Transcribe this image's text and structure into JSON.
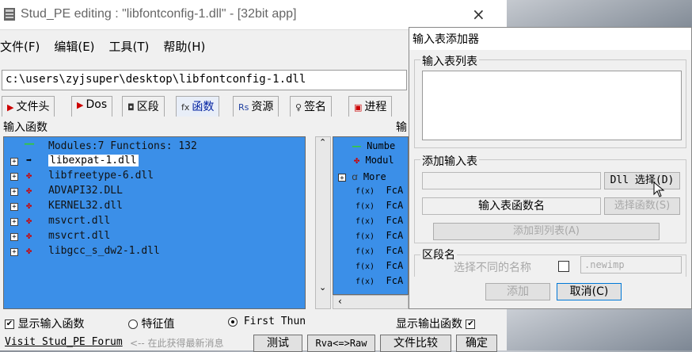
{
  "window": {
    "title": "Stud_PE editing : \"libfontconfig-1.dll\" - [32bit app]",
    "close": "×"
  },
  "menu": [
    "文件(F)",
    "编辑(E)",
    "工具(T)",
    "帮助(H)"
  ],
  "path": "c:\\users\\zyjsuper\\desktop\\libfontconfig-1.dll",
  "tabs": [
    {
      "icon": "arrow-icon",
      "label": "文件头"
    },
    {
      "icon": "arrow-icon",
      "label": "Dos"
    },
    {
      "icon": "section-icon",
      "label": "区段"
    },
    {
      "icon": "fx-icon",
      "prefix": "fx",
      "label": "函数"
    },
    {
      "icon": "resource-icon",
      "prefix": "Rs",
      "label": "资源"
    },
    {
      "icon": "sign-icon",
      "label": "签名"
    },
    {
      "icon": "process-icon",
      "label": "进程"
    }
  ],
  "imports_label": "输入函数",
  "exports_label": "输",
  "import_tree": {
    "summary": "Modules:7 Functions: 132",
    "modules": [
      "libexpat-1.dll",
      "libfreetype-6.dll",
      "ADVAPI32.DLL",
      "KERNEL32.dll",
      "msvcrt.dll",
      "msvcrt.dll",
      "libgcc_s_dw2-1.dll"
    ]
  },
  "export_tree": {
    "rows": [
      "Numbe",
      "Modul",
      "More",
      "FcA",
      "FcA",
      "FcA",
      "FcA",
      "FcA",
      "FcA",
      "FcA",
      "FcA"
    ],
    "fx": "f(x)"
  },
  "bottom": {
    "show_imports": "显示输入函数",
    "feature": "特征值",
    "first_thun": "First Thun",
    "show_exports": "显示输出函数",
    "forum": "Visit Stud_PE Forum",
    "forum_hint": "<-- 在此获得最新消息",
    "test": "测试",
    "rva": "Rva<=>Raw",
    "compare": "文件比较",
    "ok": "确定"
  },
  "dialog": {
    "title": "输入表添加器",
    "list_group": "输入表列表",
    "add_group": "添加输入表",
    "dll_select": "Dll 选择(D)",
    "func_name": "输入表函数名",
    "func_select": "选择函数(S)",
    "add_to_list": "添加到列表(A)",
    "section_group": "区段名",
    "choose_name": "选择不同的名称",
    "section_value": ".newimp",
    "add": "添加",
    "cancel": "取消(C)"
  }
}
